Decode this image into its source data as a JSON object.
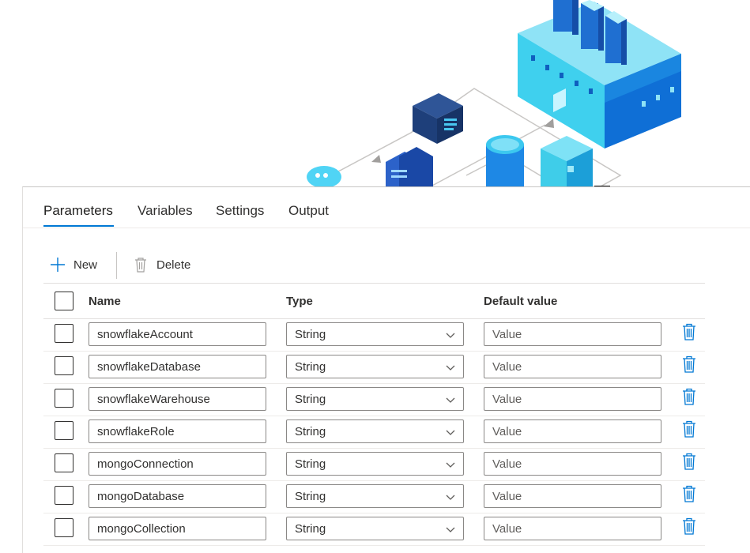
{
  "tabs": [
    {
      "label": "Parameters",
      "active": true
    },
    {
      "label": "Variables",
      "active": false
    },
    {
      "label": "Settings",
      "active": false
    },
    {
      "label": "Output",
      "active": false
    }
  ],
  "toolbar": {
    "new_label": "New",
    "new_icon": "plus-icon",
    "delete_label": "Delete",
    "delete_icon": "trash-icon"
  },
  "table": {
    "columns": [
      "Name",
      "Type",
      "Default value"
    ],
    "rows": [
      {
        "name": "snowflakeAccount",
        "type": "String",
        "default_placeholder": "Value"
      },
      {
        "name": "snowflakeDatabase",
        "type": "String",
        "default_placeholder": "Value"
      },
      {
        "name": "snowflakeWarehouse",
        "type": "String",
        "default_placeholder": "Value"
      },
      {
        "name": "snowflakeRole",
        "type": "String",
        "default_placeholder": "Value"
      },
      {
        "name": "mongoConnection",
        "type": "String",
        "default_placeholder": "Value"
      },
      {
        "name": "mongoDatabase",
        "type": "String",
        "default_placeholder": "Value"
      },
      {
        "name": "mongoCollection",
        "type": "String",
        "default_placeholder": "Value"
      }
    ]
  },
  "colors": {
    "accent": "#0078d4",
    "text": "#323130",
    "border": "#8a8886"
  }
}
